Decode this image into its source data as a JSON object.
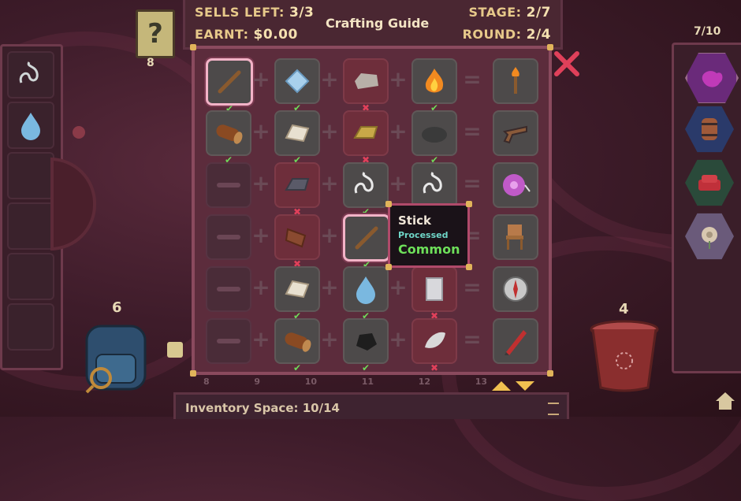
{
  "hud": {
    "sells_label": "SELLS LEFT:",
    "sells_value": "3/3",
    "earnt_label": "EARNT:",
    "earnt_value": "$0.00",
    "title": "Crafting Guide",
    "stage_label": "STAGE:",
    "stage_value": "2/7",
    "round_label": "ROUND:",
    "round_value": "2/4"
  },
  "hint": {
    "icon": "question-mark-icon",
    "count": "8"
  },
  "inventory_count": "7/10",
  "backpack_count": "6",
  "bucket_count": "4",
  "inventory_space": "Inventory Space: 10/14",
  "bottom_numbers": [
    "8",
    "9",
    "10",
    "11",
    "12",
    "13"
  ],
  "tooltip": {
    "name": "Stick",
    "state": "Processed",
    "rarity": "Common"
  },
  "recipes": [
    {
      "inputs": [
        {
          "item": "stick",
          "ok": true,
          "selected": true
        },
        {
          "item": "cloth",
          "ok": true
        },
        {
          "item": "stone",
          "ok": false
        },
        {
          "item": "fire",
          "ok": true
        }
      ],
      "result": "torch"
    },
    {
      "inputs": [
        {
          "item": "log",
          "ok": true
        },
        {
          "item": "iron-ingot",
          "ok": true
        },
        {
          "item": "gold-ingot",
          "ok": false
        },
        {
          "item": "coal-rock",
          "ok": true
        }
      ],
      "result": "flintlock-pistol"
    },
    {
      "inputs": [
        {
          "item": "empty"
        },
        {
          "item": "steel-ingot",
          "ok": false
        },
        {
          "item": "string",
          "ok": true
        },
        {
          "item": "string",
          "ok": true
        }
      ],
      "result": "yoyo"
    },
    {
      "inputs": [
        {
          "item": "empty"
        },
        {
          "item": "plank",
          "ok": false
        },
        {
          "item": "stick",
          "ok": true,
          "selected": true
        },
        {
          "item": "tooltip"
        }
      ],
      "result": "chair"
    },
    {
      "inputs": [
        {
          "item": "empty"
        },
        {
          "item": "iron-ingot",
          "ok": true
        },
        {
          "item": "water",
          "ok": true
        },
        {
          "item": "glass",
          "ok": false
        }
      ],
      "result": "compass"
    },
    {
      "inputs": [
        {
          "item": "empty"
        },
        {
          "item": "log",
          "ok": true
        },
        {
          "item": "coal",
          "ok": true
        },
        {
          "item": "feather",
          "ok": false
        }
      ],
      "result": "pencil"
    }
  ],
  "colors": {
    "accent": "#e1b45a",
    "ok": "#6ed85a",
    "bad": "#e0405a",
    "close": "#e0405a"
  }
}
